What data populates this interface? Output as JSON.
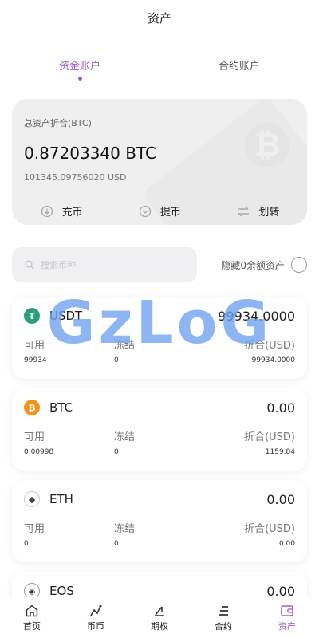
{
  "header": {
    "title": "资产"
  },
  "tabs": [
    {
      "label": "资金账户",
      "active": true
    },
    {
      "label": "合约账户",
      "active": false
    }
  ],
  "summary": {
    "label": "总资产折合(BTC)",
    "amount": "0.87203340 BTC",
    "usd": "101345.09756020 USD",
    "actions": [
      {
        "label": "充币",
        "icon": "deposit-icon"
      },
      {
        "label": "提币",
        "icon": "withdraw-icon"
      },
      {
        "label": "划转",
        "icon": "transfer-icon"
      }
    ]
  },
  "search": {
    "placeholder": "搜索币种"
  },
  "hide_zero_label": "隐藏0余额资产",
  "column_labels": {
    "available": "可用",
    "frozen": "冻结",
    "equivalent": "折合(USD)"
  },
  "assets": [
    {
      "symbol": "USDT",
      "icon": "usdt-icon",
      "color": "#26a17b",
      "total": "99934.0000",
      "available": "99934",
      "frozen": "0",
      "equivalent": "99934.0000"
    },
    {
      "symbol": "BTC",
      "icon": "btc-icon",
      "color": "#f7931a",
      "total": "0.00",
      "available": "0.00998",
      "frozen": "0",
      "equivalent": "1159.84"
    },
    {
      "symbol": "ETH",
      "icon": "eth-icon",
      "color": "#444444",
      "total": "0.00",
      "available": "0",
      "frozen": "0",
      "equivalent": "0.00"
    },
    {
      "symbol": "EOS",
      "icon": "eos-icon",
      "color": "#333333",
      "total": "0.00"
    }
  ],
  "watermark_text": "GzLoG",
  "nav": [
    {
      "label": "首页",
      "icon": "home-icon",
      "active": false
    },
    {
      "label": "币币",
      "icon": "spot-icon",
      "active": false
    },
    {
      "label": "期权",
      "icon": "options-icon",
      "active": false
    },
    {
      "label": "合约",
      "icon": "contract-icon",
      "active": false
    },
    {
      "label": "资产",
      "icon": "wallet-icon",
      "active": true
    }
  ],
  "colors": {
    "accent": "#a25ec6",
    "watermark": "#6ea0f0"
  }
}
